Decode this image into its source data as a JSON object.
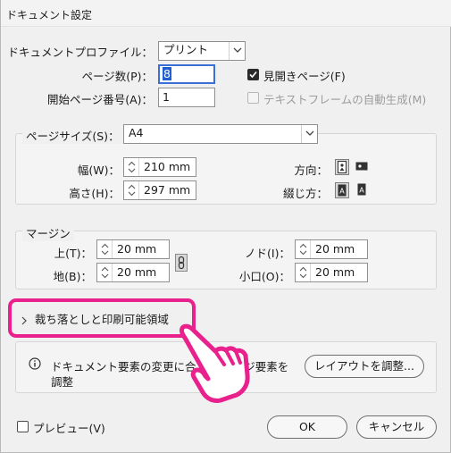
{
  "window": {
    "title": "ドキュメント設定"
  },
  "profile": {
    "label": "ドキュメントプロファイル：",
    "value": "プリント"
  },
  "pages": {
    "label": "ページ数(P)：",
    "value": "8"
  },
  "start_page": {
    "label": "開始ページ番号(A)：",
    "value": "1"
  },
  "facing_pages": {
    "label": "見開きページ(F)",
    "checked": true
  },
  "text_frame": {
    "label": "テキストフレームの自動生成(M)",
    "checked": false,
    "disabled": true
  },
  "page_size": {
    "label": "ページサイズ(S)：",
    "value": "A4",
    "width_label": "幅(W)：",
    "width_value": "210 mm",
    "height_label": "高さ(H)：",
    "height_value": "297 mm",
    "orientation_label": "方向：",
    "binding_label": "綴じ方："
  },
  "margins": {
    "legend": "マージン",
    "top_label": "上(T)：",
    "top_value": "20 mm",
    "bottom_label": "地(B)：",
    "bottom_value": "20 mm",
    "inside_label": "ノド(I)：",
    "inside_value": "20 mm",
    "outside_label": "小口(O)：",
    "outside_value": "20 mm"
  },
  "bleed": {
    "label": "裁ち落としと印刷可能領域"
  },
  "info": {
    "text_line1_a": "ドキュメント要素の変更に合",
    "text_line1_b": "ージ要素を",
    "text_line2": "調整",
    "adjust_button": "レイアウトを調整..."
  },
  "preview": {
    "label": "プレビュー(V)",
    "checked": false
  },
  "buttons": {
    "ok": "OK",
    "cancel": "キャンセル"
  },
  "colors": {
    "highlight": "#e8218c",
    "hand_fill": "#ffffff",
    "hand_stroke": "#e8218c"
  }
}
